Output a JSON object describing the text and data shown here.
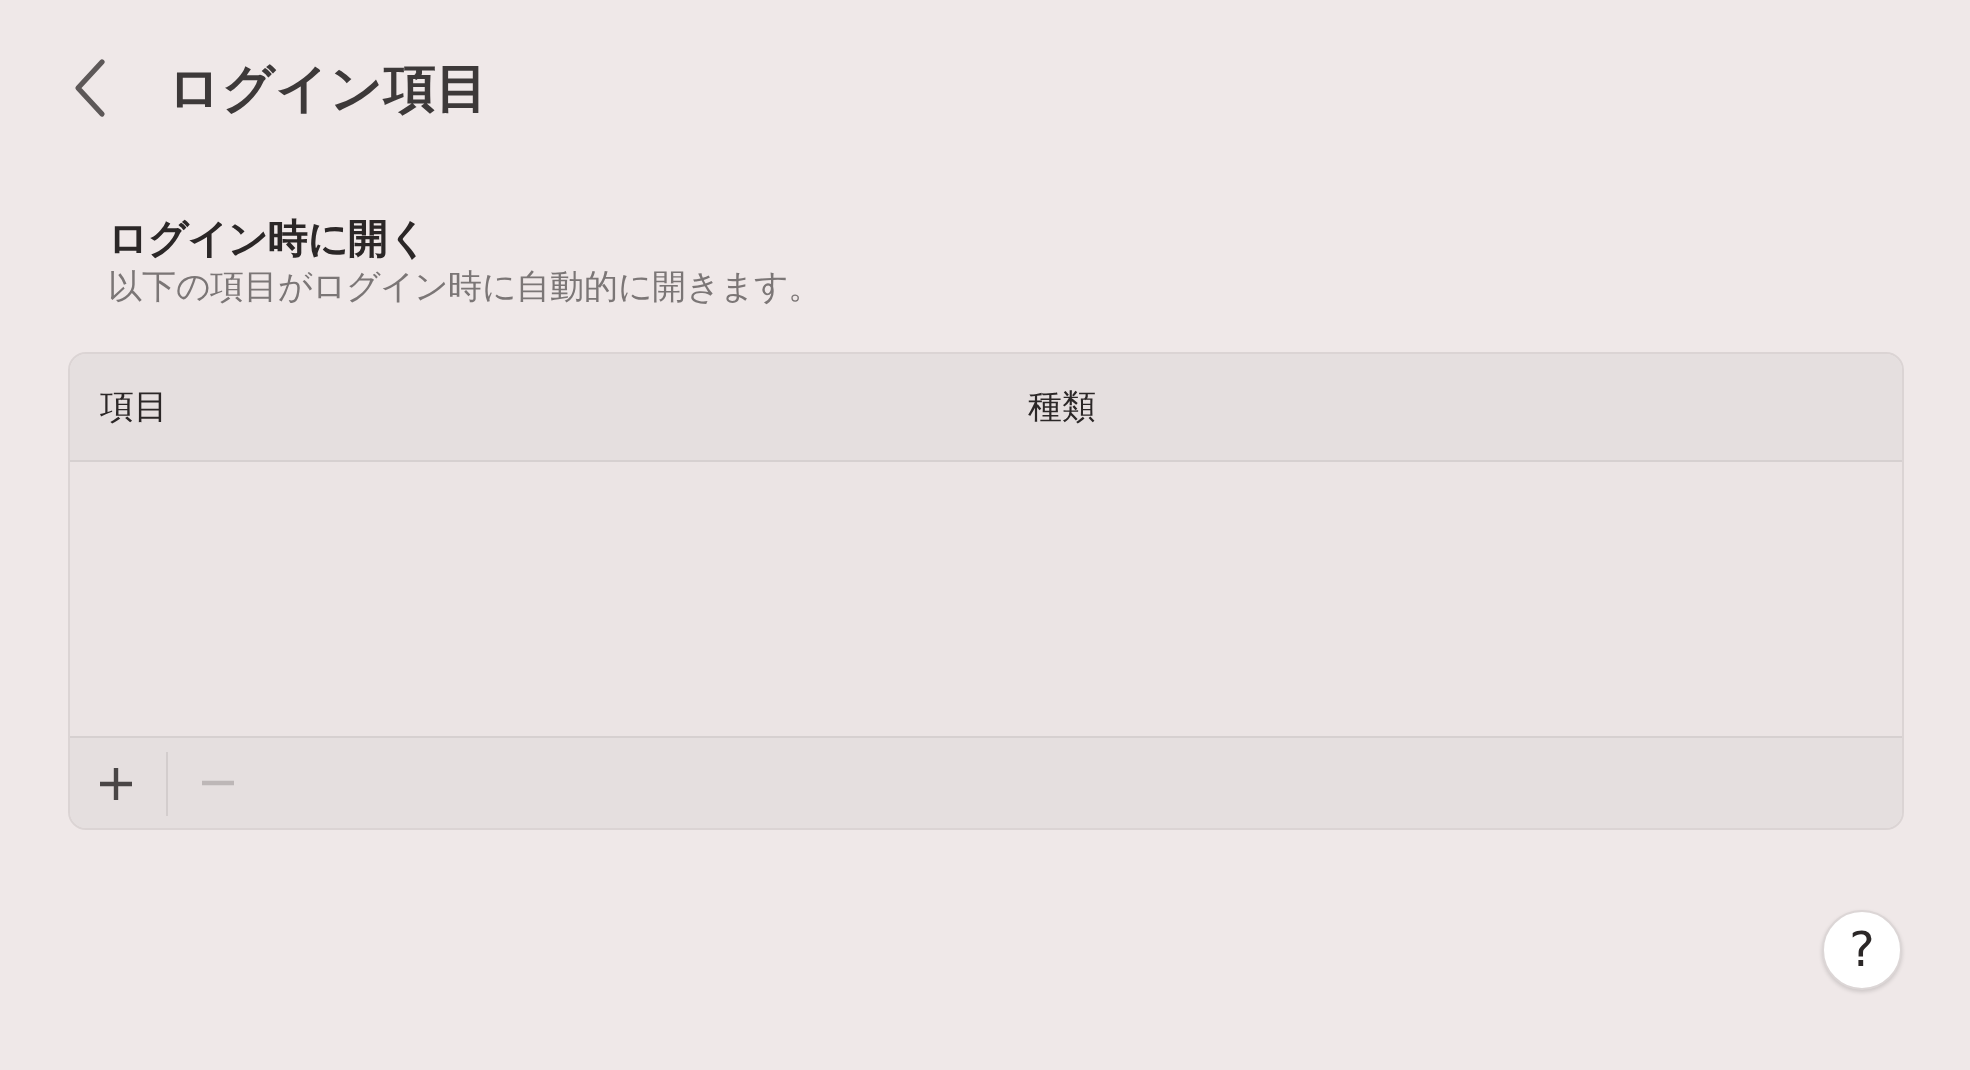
{
  "header": {
    "title": "ログイン項目"
  },
  "section": {
    "heading": "ログイン時に開く",
    "description": "以下の項目がログイン時に自動的に開きます。"
  },
  "table": {
    "columns": [
      "項目",
      "種類"
    ]
  },
  "toolbar": [
    {
      "kind": "add",
      "disabled": false
    },
    {
      "kind": "remove",
      "disabled": true
    }
  ],
  "help": {
    "label": "?"
  }
}
